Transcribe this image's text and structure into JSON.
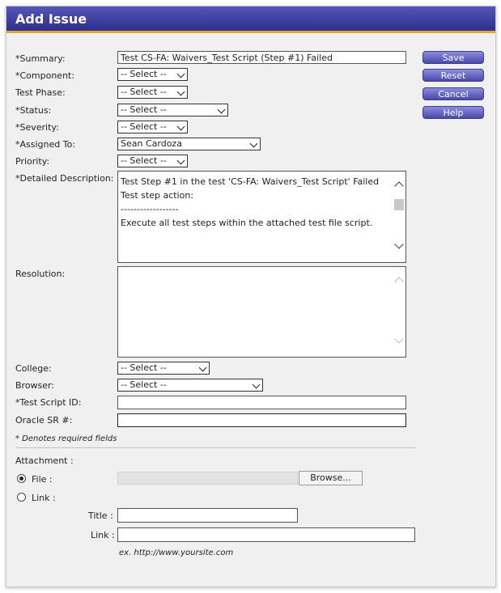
{
  "header": {
    "title": "Add Issue"
  },
  "form": {
    "summary": {
      "label": "*Summary:",
      "value": "Test CS-FA: Waivers_Test Script (Step #1) Failed"
    },
    "component": {
      "label": "*Component:",
      "value": "-- Select --"
    },
    "test_phase": {
      "label": "Test Phase:",
      "value": "-- Select --"
    },
    "status": {
      "label": "*Status:",
      "value": "-- Select --"
    },
    "severity": {
      "label": "*Severity:",
      "value": "-- Select --"
    },
    "assigned_to": {
      "label": "*Assigned To:",
      "value": "Sean Cardoza"
    },
    "priority": {
      "label": "Priority:",
      "value": "-- Select --"
    },
    "description": {
      "label": "*Detailed Description:",
      "lines": [
        "Test Step #1 in the test 'CS-FA: Waivers_Test Script' Failed",
        "",
        "",
        "Test step action:",
        "------------------",
        "Execute all test steps within the attached test file script."
      ]
    },
    "resolution": {
      "label": "Resolution:",
      "value": ""
    },
    "college": {
      "label": "College:",
      "value": "-- Select --"
    },
    "browser": {
      "label": "Browser:",
      "value": "-- Select --"
    },
    "test_script_id": {
      "label": "*Test Script ID:",
      "value": ""
    },
    "oracle_sr": {
      "label": "Oracle SR #:",
      "value": ""
    },
    "required_note": "* Denotes required fields"
  },
  "buttons": {
    "save": "Save",
    "reset": "Reset",
    "cancel": "Cancel",
    "help": "Help"
  },
  "attachment": {
    "label": "Attachment :",
    "file_label": "File :",
    "link_label": "Link :",
    "selected": "file",
    "browse": "Browse...",
    "title_label": "Title :",
    "link_field_label": "Link :",
    "example": "ex. http://www.yoursite.com"
  }
}
